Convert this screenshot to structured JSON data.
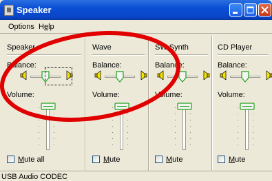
{
  "window": {
    "title": "Speaker",
    "icon": "speaker-window-icon"
  },
  "title_buttons": [
    "minimize-icon",
    "maximize-icon",
    "close-icon"
  ],
  "menu": {
    "options_label": "Options",
    "help_prefix": "H",
    "help_underlined": "e",
    "help_rest": "lp"
  },
  "panels": [
    {
      "title": "Speaker",
      "balance_label": "Balance:",
      "volume_label": "Volume:",
      "mute_underlined": "M",
      "mute_rest": "ute all",
      "mute_checked": false,
      "balance": 0.5,
      "volume": 1.0
    },
    {
      "title": "Wave",
      "balance_label": "Balance:",
      "volume_label": "Volume:",
      "mute_underlined": "M",
      "mute_rest": "ute",
      "mute_checked": false,
      "balance": 0.5,
      "volume": 1.0
    },
    {
      "title": "SW Synth",
      "balance_label": "Balance:",
      "volume_label": "Volume:",
      "mute_underlined": "M",
      "mute_rest": "ute",
      "mute_checked": false,
      "balance": 0.5,
      "volume": 1.0
    },
    {
      "title": "CD Player",
      "balance_label": "Balance:",
      "volume_label": "Volume:",
      "mute_underlined": "M",
      "mute_rest": "ute",
      "mute_checked": false,
      "balance": 0.5,
      "volume": 1.0
    }
  ],
  "status": {
    "text": "USB Audio CODEC"
  },
  "annotation": {
    "shape": "ellipse",
    "color": "#e00000"
  }
}
